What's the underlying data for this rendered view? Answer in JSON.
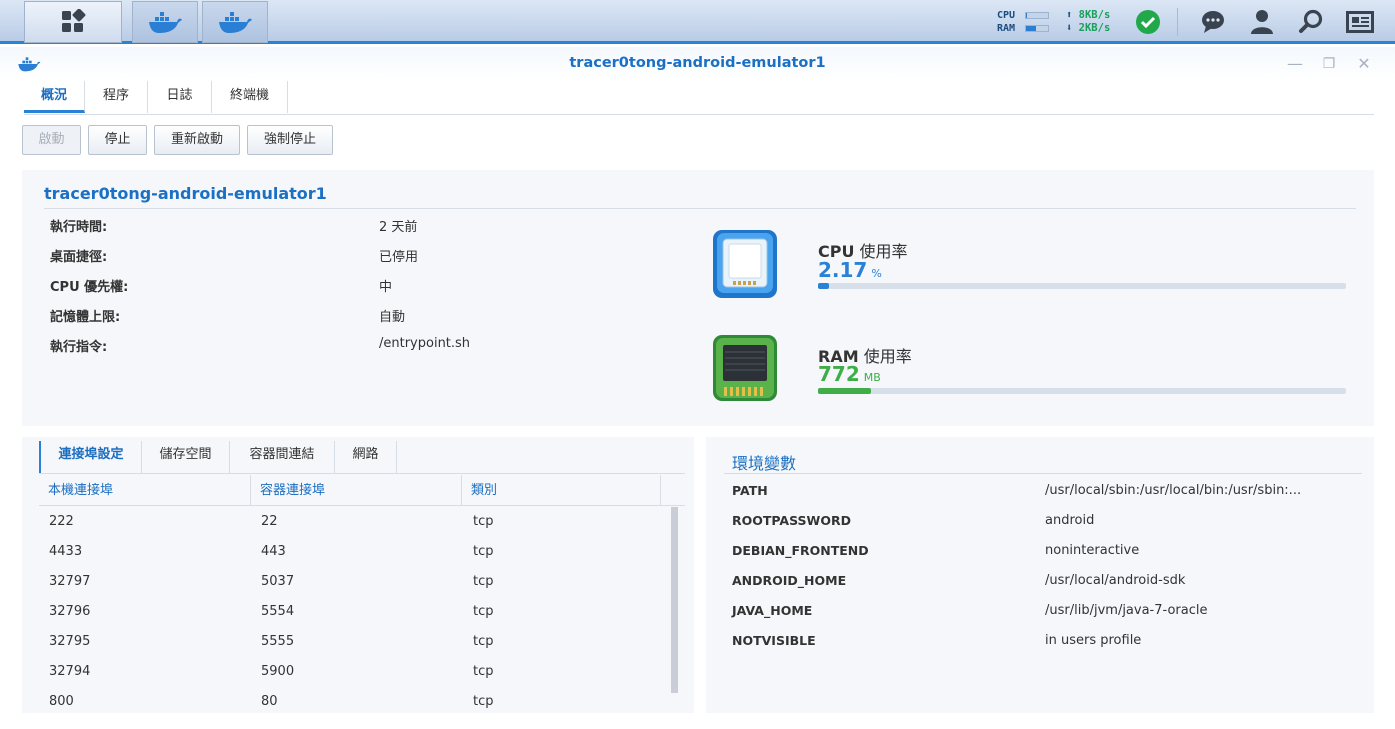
{
  "taskbar": {
    "meter": {
      "cpu_label": "CPU",
      "ram_label": "RAM",
      "cpu_fraction": 0.05,
      "ram_fraction": 0.45
    },
    "speed": {
      "up": "8KB/s",
      "down": "2KB/s",
      "up_arrow": "⬆",
      "down_arrow": "⬇"
    },
    "icons": [
      "main-menu-icon",
      "docker-icon",
      "docker-icon",
      "status-ok-icon",
      "chat-icon",
      "user-icon",
      "search-icon",
      "widget-icon"
    ]
  },
  "window": {
    "title": "tracer0tong-android-emulator1",
    "controls": {
      "minimize": "—",
      "restore": "❐",
      "close": "✕"
    }
  },
  "tabs": [
    "概況",
    "程序",
    "日誌",
    "終端機"
  ],
  "buttons": {
    "start": "啟動",
    "stop": "停止",
    "restart": "重新啟動",
    "force_stop": "強制停止"
  },
  "info": {
    "name": "tracer0tong-android-emulator1",
    "rows": [
      {
        "label": "執行時間:",
        "value": "2 天前"
      },
      {
        "label": "桌面捷徑:",
        "value": "已停用"
      },
      {
        "label": "CPU 優先權:",
        "value": "中"
      },
      {
        "label": "記憶體上限:",
        "value": "自動"
      },
      {
        "label": "執行指令:",
        "value": "/entrypoint.sh"
      }
    ],
    "cpu": {
      "title_a": "CPU",
      "title_b": " 使用率",
      "value": "2.17",
      "unit": "%",
      "fraction": 0.02,
      "color": "#2a82d5"
    },
    "ram": {
      "title_a": "RAM",
      "title_b": " 使用率",
      "value": "772",
      "unit": "MB",
      "fraction": 0.1,
      "color": "#3fae49"
    }
  },
  "ports": {
    "tabs": [
      "連接埠設定",
      "儲存空間",
      "容器間連結",
      "網路"
    ],
    "headers": [
      "本機連接埠",
      "容器連接埠",
      "類別"
    ],
    "rows": [
      [
        "222",
        "22",
        "tcp"
      ],
      [
        "4433",
        "443",
        "tcp"
      ],
      [
        "32797",
        "5037",
        "tcp"
      ],
      [
        "32796",
        "5554",
        "tcp"
      ],
      [
        "32795",
        "5555",
        "tcp"
      ],
      [
        "32794",
        "5900",
        "tcp"
      ],
      [
        "800",
        "80",
        "tcp"
      ]
    ]
  },
  "env": {
    "title": "環境變數",
    "rows": [
      {
        "key": "PATH",
        "value": "/usr/local/sbin:/usr/local/bin:/usr/sbin:..."
      },
      {
        "key": "ROOTPASSWORD",
        "value": "android"
      },
      {
        "key": "DEBIAN_FRONTEND",
        "value": "noninteractive"
      },
      {
        "key": "ANDROID_HOME",
        "value": "/usr/local/android-sdk"
      },
      {
        "key": "JAVA_HOME",
        "value": "/usr/lib/jvm/java-7-oracle"
      },
      {
        "key": "NOTVISIBLE",
        "value": "in users profile"
      }
    ]
  }
}
